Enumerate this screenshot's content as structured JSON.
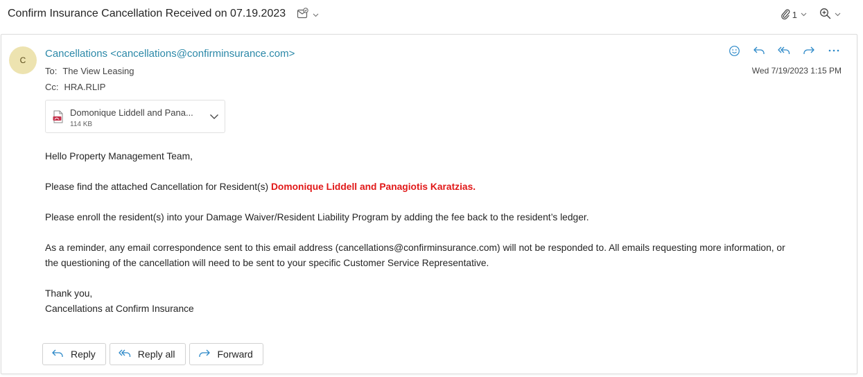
{
  "subject": {
    "title": "Confirm Insurance Cancellation Received on 07.19.2023",
    "attachment_count": "1"
  },
  "message": {
    "avatar_initial": "C",
    "from": "Cancellations <cancellations@confirminsurance.com>",
    "to_label": "To:",
    "to_value": "The View Leasing",
    "cc_label": "Cc:",
    "cc_value": "HRA.RLIP",
    "date": "Wed 7/19/2023 1:15 PM",
    "attachment": {
      "name": "Domonique Liddell and Pana...",
      "size": "114 KB"
    },
    "body": {
      "greeting": "Hello Property Management Team,",
      "p1_prefix": "Please find the attached Cancellation for Resident(s) ",
      "p1_highlight": "Domonique Liddell and Panagiotis Karatzias.",
      "p2": "Please enroll the resident(s) into your Damage Waiver/Resident Liability Program by adding the fee back to the resident’s ledger.",
      "p3_line1": "As a reminder, any email correspondence sent to this email address (cancellations@confirminsurance.com) will not be responded to. All emails requesting more information, or",
      "p3_line2": "the questioning of the cancellation will need to be sent to your specific Customer Service Representative.",
      "closing": "Thank you,",
      "signature": "Cancellations at Confirm Insurance"
    }
  },
  "buttons": {
    "reply": "Reply",
    "reply_all": "Reply all",
    "forward": "Forward"
  },
  "colors": {
    "accent": "#2b88c8",
    "highlight_red": "#e11818",
    "avatar_bg": "#ede3b0"
  },
  "icons": [
    "mail-check-icon",
    "paperclip-icon",
    "zoom-icon",
    "emoji-icon",
    "reply-icon",
    "reply-all-icon",
    "forward-icon",
    "more-icon",
    "pdf-icon",
    "chevron-down-icon"
  ]
}
